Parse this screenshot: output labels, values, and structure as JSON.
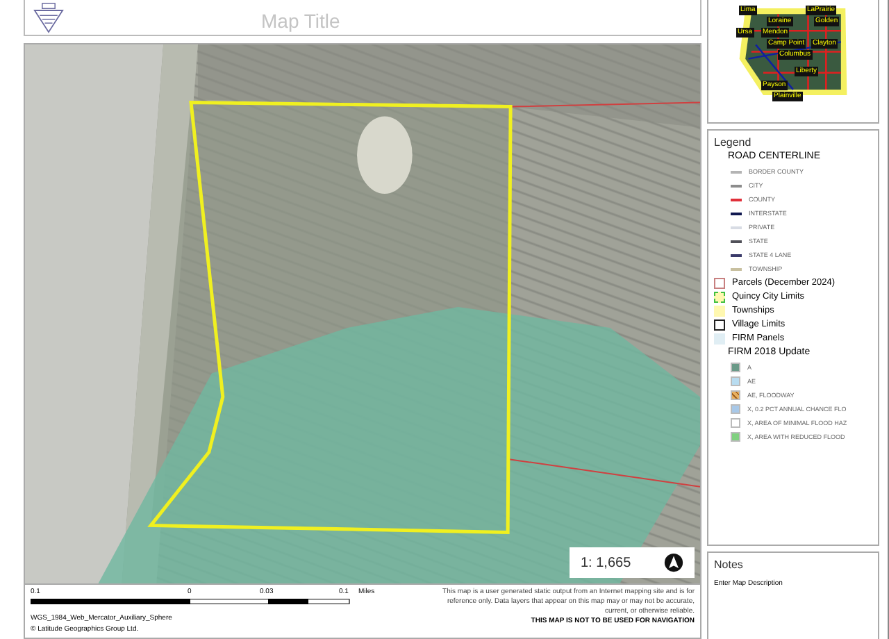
{
  "title": "Map Title",
  "overview": {
    "places": [
      "Lima",
      "Loraine",
      "LaPrairie",
      "Golden",
      "Ursa",
      "Mendon",
      "Camp Point",
      "Clayton",
      "Columbus",
      "Liberty",
      "Payson",
      "Plainville"
    ]
  },
  "legend": {
    "title": "Legend",
    "items": [
      {
        "kind": "heading",
        "label": "ROAD CENTERLINE"
      },
      {
        "kind": "line",
        "label": "BORDER COUNTY",
        "color": "#b4b4b4"
      },
      {
        "kind": "line",
        "label": "CITY",
        "color": "#8c8c8c"
      },
      {
        "kind": "line",
        "label": "COUNTY",
        "color": "#e0303a"
      },
      {
        "kind": "line",
        "label": "INTERSTATE",
        "color": "#101850"
      },
      {
        "kind": "line",
        "label": "PRIVATE",
        "color": "#d8dce4"
      },
      {
        "kind": "line",
        "label": "STATE",
        "color": "#505058"
      },
      {
        "kind": "line",
        "label": "STATE 4 LANE",
        "color": "#3a3a6a"
      },
      {
        "kind": "line",
        "label": "TOWNSHIP",
        "color": "#c8c0a0"
      },
      {
        "kind": "box",
        "label": "Parcels (December 2024)",
        "color": "#c88080"
      },
      {
        "kind": "dashed",
        "label": "Quincy City Limits",
        "color": "#40c040"
      },
      {
        "kind": "fill",
        "label": "Townships",
        "color": "#fff8b0"
      },
      {
        "kind": "box",
        "label": "Village Limits",
        "color": "#202020"
      },
      {
        "kind": "fill",
        "label": "FIRM Panels",
        "color": "#e0eef4"
      },
      {
        "kind": "heading",
        "label": "FIRM 2018 Update"
      },
      {
        "kind": "swatch",
        "label": "A",
        "color": "#6a9a88"
      },
      {
        "kind": "swatch",
        "label": "AE",
        "color": "#b8dcf0"
      },
      {
        "kind": "hatch",
        "label": "AE, FLOODWAY",
        "color": "#e8b060"
      },
      {
        "kind": "swatch",
        "label": "X, 0.2 PCT ANNUAL CHANCE FLO",
        "color": "#a8c8e8"
      },
      {
        "kind": "swatch",
        "label": "X, AREA OF MINIMAL FLOOD HAZ",
        "color": "#ffffff"
      },
      {
        "kind": "swatch",
        "label": "X, AREA WITH REDUCED FLOOD",
        "color": "#80d080"
      }
    ]
  },
  "scale": "1: 1,665",
  "scalebar": {
    "ticks": [
      "0.1",
      "0",
      "0.03",
      "0.1"
    ],
    "unit": "Miles"
  },
  "projection": "WGS_1984_Web_Mercator_Auxiliary_Sphere",
  "copyright": "© Latitude Geographics Group Ltd.",
  "disclaimer": "This map is a user generated static output from an Internet mapping site and is for reference only. Data layers that appear on this map may or may not be accurate, current, or otherwise reliable.",
  "warning": "THIS MAP IS NOT TO BE USED FOR NAVIGATION",
  "notes": {
    "title": "Notes",
    "text": "Enter Map Description"
  }
}
